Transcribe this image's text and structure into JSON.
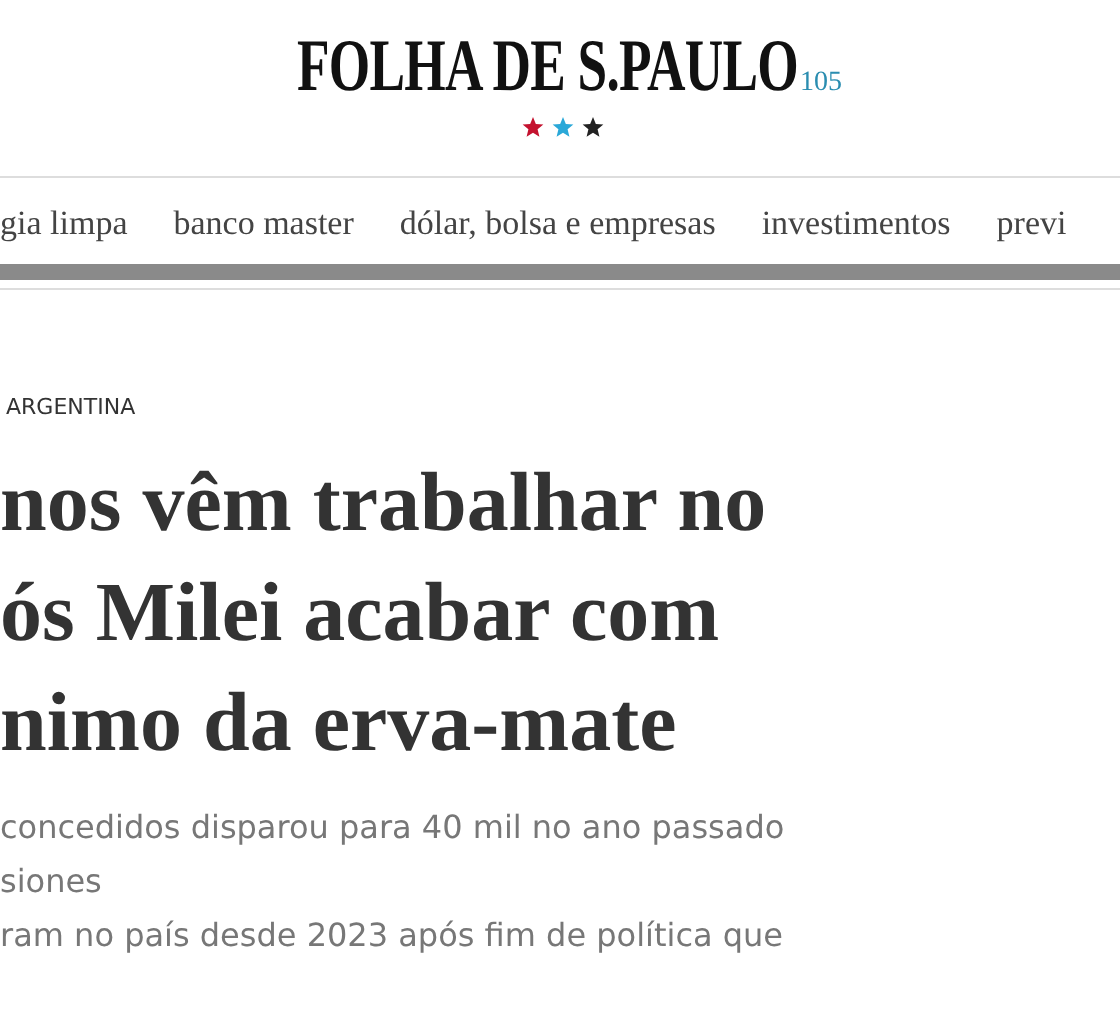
{
  "masthead": {
    "title": "FOLHA DE S.PAULO",
    "edition": "105",
    "marks": [
      {
        "color": "#c4122f"
      },
      {
        "color": "#2aa8d8"
      },
      {
        "color": "#222222"
      }
    ]
  },
  "nav": {
    "items": [
      "gia limpa",
      "banco master",
      "dólar, bolsa e empresas",
      "investimentos",
      "previ"
    ]
  },
  "article": {
    "kicker": "ARGENTINA",
    "headline": [
      "nos vêm trabalhar no",
      "ós Milei acabar com",
      "nimo da erva-mate"
    ],
    "subtitle": [
      "concedidos disparou para 40 mil no ano passado",
      "siones",
      "ram no país desde 2023 após fim de política que"
    ]
  }
}
